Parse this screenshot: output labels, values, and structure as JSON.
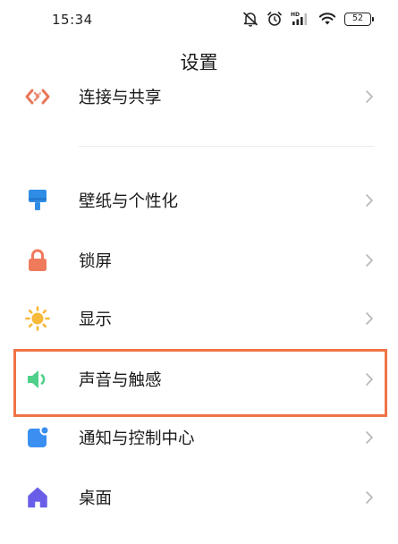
{
  "status_bar": {
    "time": "15:34",
    "battery_level": "52",
    "icons": [
      "mute-icon",
      "alarm-icon",
      "hd-signal-icon",
      "wifi-icon",
      "battery-icon"
    ]
  },
  "page": {
    "title": "设置"
  },
  "settings": {
    "connection_sharing": "连接与共享",
    "wallpaper": "壁纸与个性化",
    "lock_screen": "锁屏",
    "display": "显示",
    "sound": "声音与触感",
    "notifications": "通知与控制中心",
    "home_screen": "桌面"
  },
  "colors": {
    "connection_sharing": "#e8775a",
    "wallpaper": "#2f8de6",
    "lock_screen": "#f07a5c",
    "display": "#f6b93a",
    "sound": "#4fd08a",
    "notifications": "#3a8ff0",
    "home_screen": "#6a5ee8",
    "highlight": "#ef7446"
  }
}
